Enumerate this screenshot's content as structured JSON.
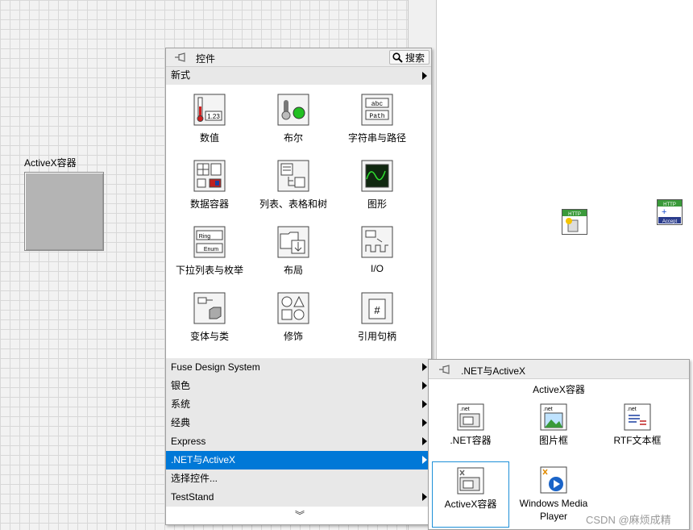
{
  "front_panel": {
    "activex_label": "ActiveX容器"
  },
  "palette": {
    "title": "控件",
    "search_label": "搜索",
    "submenu_label": "新式",
    "tiles": [
      {
        "label": "数值",
        "icon": "numeric-icon"
      },
      {
        "label": "布尔",
        "icon": "boolean-icon"
      },
      {
        "label": "字符串与路径",
        "icon": "string-path-icon"
      },
      {
        "label": "数据容器",
        "icon": "data-container-icon"
      },
      {
        "label": "列表、表格和树",
        "icon": "list-table-tree-icon"
      },
      {
        "label": "图形",
        "icon": "graph-icon"
      },
      {
        "label": "下拉列表与枚举",
        "icon": "ring-enum-icon"
      },
      {
        "label": "布局",
        "icon": "layout-icon"
      },
      {
        "label": "I/O",
        "icon": "io-icon"
      },
      {
        "label": "变体与类",
        "icon": "variant-class-icon"
      },
      {
        "label": "修饰",
        "icon": "decorations-icon"
      },
      {
        "label": "引用句柄",
        "icon": "refnum-icon"
      }
    ],
    "icon_text": {
      "numeric": "1.23",
      "string_top": "abc",
      "string_bottom": "Path",
      "ring": "Ring",
      "enum": "Enum"
    },
    "menu": [
      {
        "label": "Fuse Design System",
        "submenu": true
      },
      {
        "label": "银色",
        "submenu": true
      },
      {
        "label": "系统",
        "submenu": true
      },
      {
        "label": "经典",
        "submenu": true
      },
      {
        "label": "Express",
        "submenu": true
      },
      {
        "label": ".NET与ActiveX",
        "submenu": true,
        "selected": true
      },
      {
        "label": "选择控件...",
        "submenu": false
      },
      {
        "label": "TestStand",
        "submenu": true
      }
    ],
    "more_glyph": "︾"
  },
  "subpalette": {
    "title": ".NET与ActiveX",
    "caption": "ActiveX容器",
    "tiles": [
      {
        "label": ".NET容器",
        "icon": "net-container-icon",
        "badge": ".net"
      },
      {
        "label": "图片框",
        "icon": "picture-box-icon",
        "badge": ".net"
      },
      {
        "label": "RTF文本框",
        "icon": "rtf-textbox-icon",
        "badge": ".net"
      },
      {
        "label": "ActiveX容器",
        "icon": "activex-container-icon",
        "badge": ""
      },
      {
        "label": "Windows Media Player",
        "icon": "media-player-icon",
        "badge": ""
      }
    ]
  },
  "block_diagram": {
    "http_label": "HTTP",
    "accept_label": "Accept"
  },
  "watermark": "CSDN @麻烦成精",
  "colors": {
    "selection": "#0078d7",
    "accent_border": "#1e90d8"
  }
}
